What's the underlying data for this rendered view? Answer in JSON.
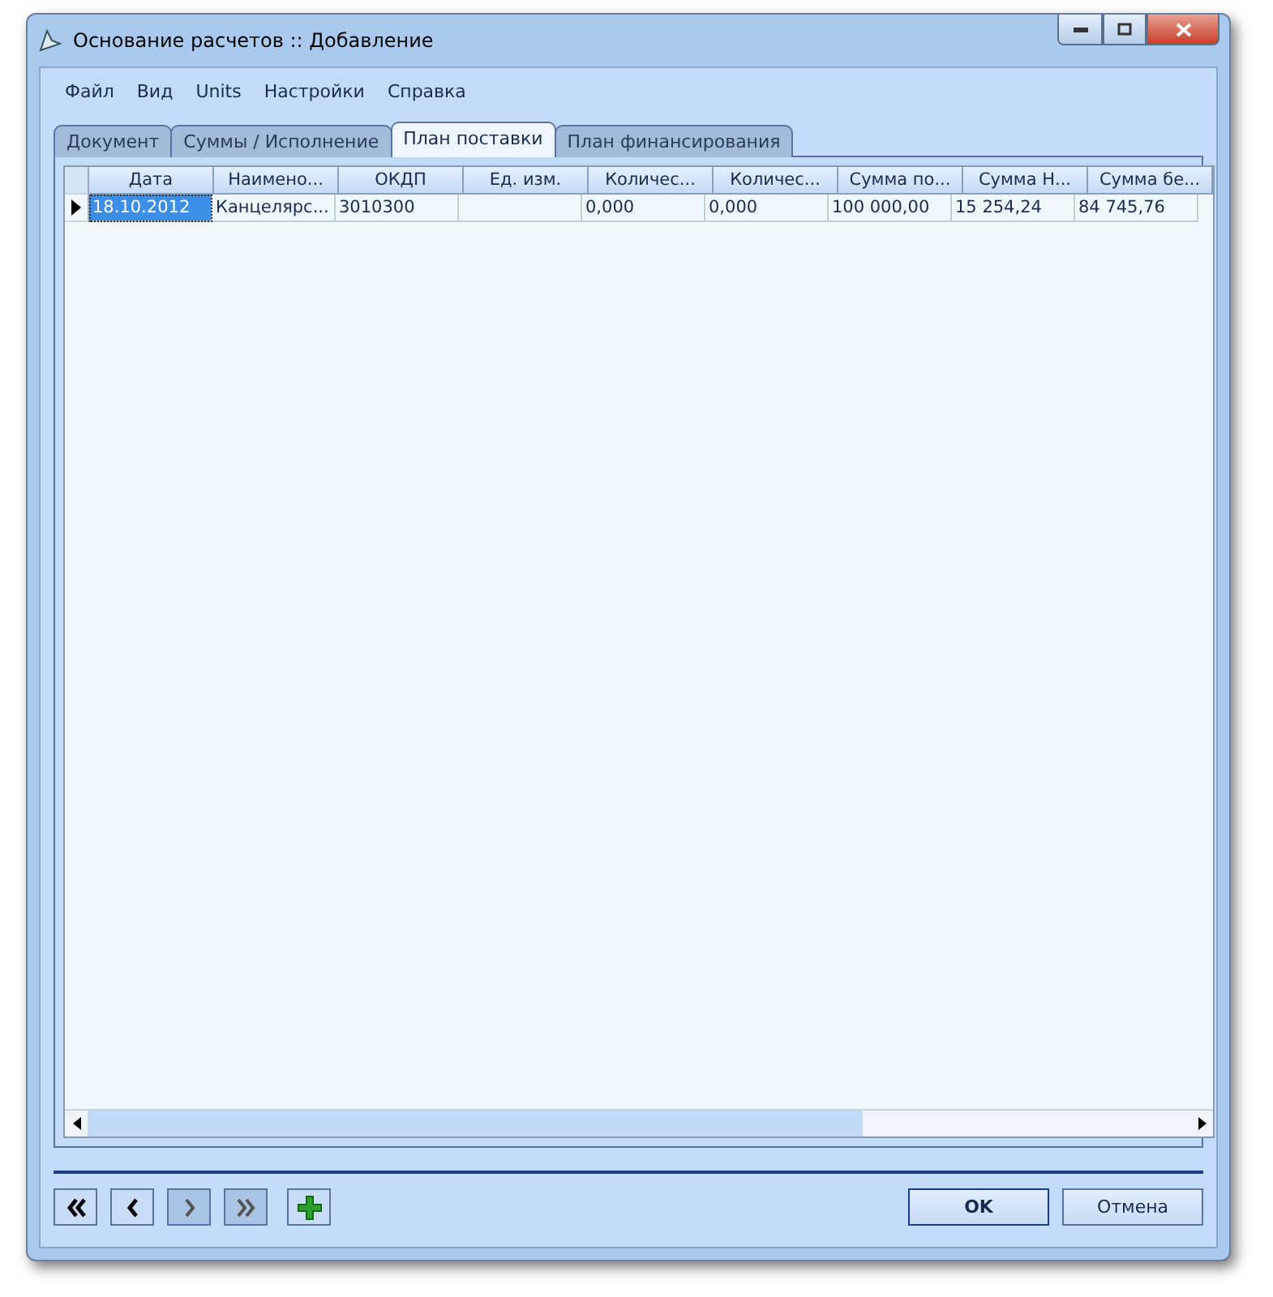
{
  "window": {
    "title": "Основание расчетов :: Добавление"
  },
  "menu": [
    "Файл",
    "Вид",
    "Units",
    "Настройки",
    "Справка"
  ],
  "tabs": [
    {
      "label": "Документ",
      "selected": false
    },
    {
      "label": "Суммы / Исполнение",
      "selected": false
    },
    {
      "label": "План поставки",
      "selected": true
    },
    {
      "label": "План финансирования",
      "selected": false
    }
  ],
  "table": {
    "columns": [
      "Дата",
      "Наимено...",
      "ОКДП",
      "Ед. изм.",
      "Количес...",
      "Количес...",
      "Сумма по...",
      "Сумма Н...",
      "Сумма бе..."
    ],
    "rows": [
      {
        "selected": true,
        "cells": [
          "18.10.2012",
          "Канцелярс...",
          "3010300",
          "",
          "0,000",
          "0,000",
          "100 000,00",
          "15 254,24",
          "84 745,76"
        ]
      }
    ]
  },
  "nav_buttons": [
    {
      "kind": "first",
      "disabled": false
    },
    {
      "kind": "prev",
      "disabled": false
    },
    {
      "kind": "next",
      "disabled": true
    },
    {
      "kind": "last",
      "disabled": true
    },
    {
      "kind": "add",
      "disabled": false
    }
  ],
  "buttons": [
    {
      "label": "OK",
      "default": true
    },
    {
      "label": "Отмена",
      "default": false
    }
  ]
}
